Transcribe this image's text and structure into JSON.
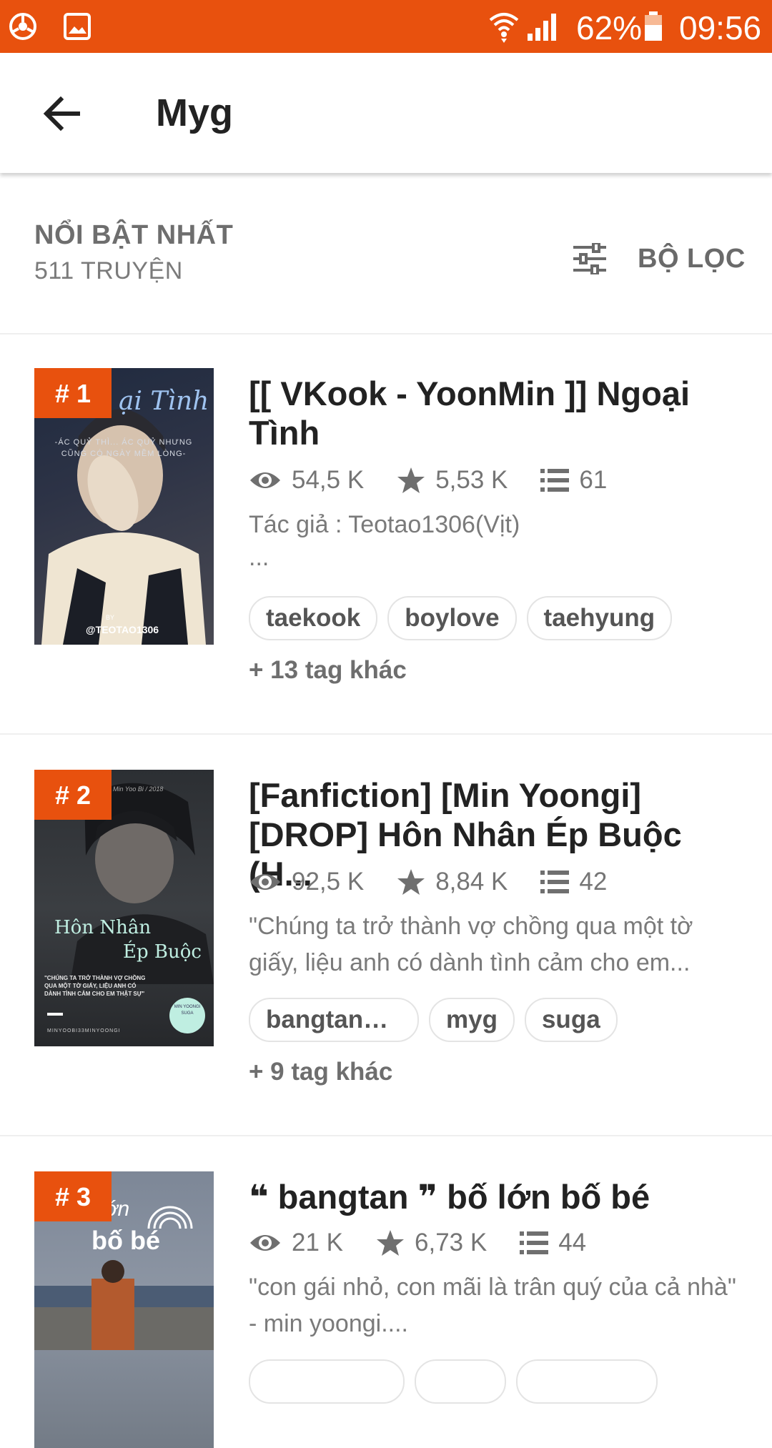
{
  "status_bar": {
    "battery": "62%",
    "time": "09:56",
    "bg_color": "#e8510e"
  },
  "header": {
    "title": "Myg"
  },
  "sort": {
    "label": "NỔI BẬT NHẤT",
    "count": "511 TRUYỆN",
    "filter_label": "BỘ LỌC"
  },
  "stories": [
    {
      "rank": "# 1",
      "title": "[[ VKook - YoonMin ]] Ngoại Tình",
      "views": "54,5 K",
      "votes": "5,53 K",
      "parts": "61",
      "description_lines": [
        "Tác giả : Teotao1306(Vịt)",
        "..."
      ],
      "tags": [
        "taekook",
        "boylove",
        "taehyung"
      ],
      "more_tags": "+ 13 tag khác",
      "cover_text": {
        "title": "ại Tình",
        "tagline": "-ÁC QUỶ THÌ... ÁC QUỶ NHƯNG CŨNG CÓ NGÀY MỀM LÒNG-",
        "by": "BY",
        "author": "@TEOTAO1306"
      }
    },
    {
      "rank": "# 2",
      "title": "[Fanfiction] [Min Yoongi] [DROP] Hôn Nhân Ép Buộc (H...",
      "views": "92,5 K",
      "votes": "8,84 K",
      "parts": "42",
      "description_lines": [
        "\"Chúng ta trở thành vợ chồng qua một tờ giấy, liệu anh có dành tình cảm cho em..."
      ],
      "tags": [
        "bangtanso...",
        "myg",
        "suga"
      ],
      "more_tags": "+ 9 tag khác",
      "cover_text": {
        "header": "Min Yoo Bi / 2018",
        "title1": "Hôn Nhân",
        "title2": "Ép Buộc",
        "quote": "\"CHÚNG TA TRỞ THÀNH VỢ CHỒNG QUA MỘT TỜ GIẤY, LIỆU ANH CÓ DÀNH TÌNH CẢM CHO EM THẬT SỰ\"",
        "footer": "MINYOOBI33MINYOONGI",
        "badge": "MIN YOONGI SUGA"
      }
    },
    {
      "rank": "# 3",
      "title": "❝ bangtan ❞ bố lớn bố bé",
      "views": "21 K",
      "votes": "6,73 K",
      "parts": "44",
      "description_lines": [
        "\"con gái nhỏ, con mãi là trân quý của cả nhà\" - min yoongi...."
      ],
      "tags": [],
      "more_tags": "",
      "cover_text": {
        "line1": "bố lớn",
        "line2": "bố bé"
      }
    }
  ]
}
